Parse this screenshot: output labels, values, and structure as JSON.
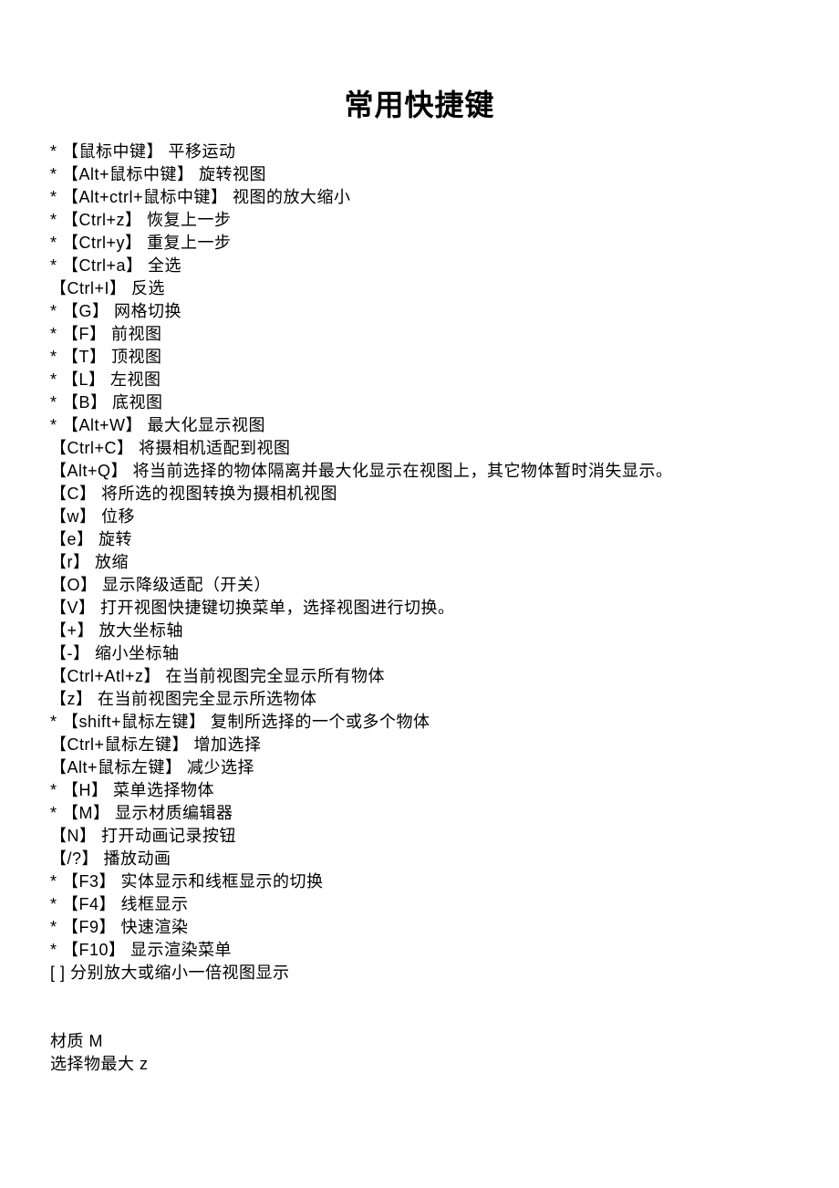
{
  "title": "常用快捷键",
  "lines": [
    "* 【鼠标中键】 平移运动",
    "* 【Alt+鼠标中键】 旋转视图",
    "* 【Alt+ctrl+鼠标中键】 视图的放大缩小",
    "* 【Ctrl+z】 恢复上一步",
    "* 【Ctrl+y】 重复上一步",
    "* 【Ctrl+a】 全选",
    "【Ctrl+I】 反选",
    "* 【G】 网格切换",
    "* 【F】 前视图",
    "* 【T】 顶视图",
    "* 【L】 左视图",
    "* 【B】 底视图",
    "* 【Alt+W】 最大化显示视图",
    "【Ctrl+C】 将摄相机适配到视图",
    "【Alt+Q】 将当前选择的物体隔离并最大化显示在视图上，其它物体暂时消失显示。",
    "【C】 将所选的视图转换为摄相机视图",
    "【w】 位移",
    "【e】 旋转",
    "【r】 放缩",
    "【O】 显示降级适配（开关）",
    "【V】 打开视图快捷键切换菜单，选择视图进行切换。",
    "【+】 放大坐标轴",
    "【-】 缩小坐标轴",
    "【Ctrl+Atl+z】 在当前视图完全显示所有物体",
    "【z】 在当前视图完全显示所选物体",
    "* 【shift+鼠标左键】 复制所选择的一个或多个物体",
    "【Ctrl+鼠标左键】 增加选择",
    "【Alt+鼠标左键】 减少选择",
    "* 【H】 菜单选择物体",
    "* 【M】 显示材质编辑器",
    "【N】 打开动画记录按钮",
    "【/?】 播放动画",
    "* 【F3】 实体显示和线框显示的切换",
    "* 【F4】 线框显示",
    "* 【F9】 快速渲染",
    "* 【F10】 显示渲染菜单",
    "[ ] 分别放大或缩小一倍视图显示"
  ],
  "footer": [
    "材质 M",
    "选择物最大 z"
  ]
}
